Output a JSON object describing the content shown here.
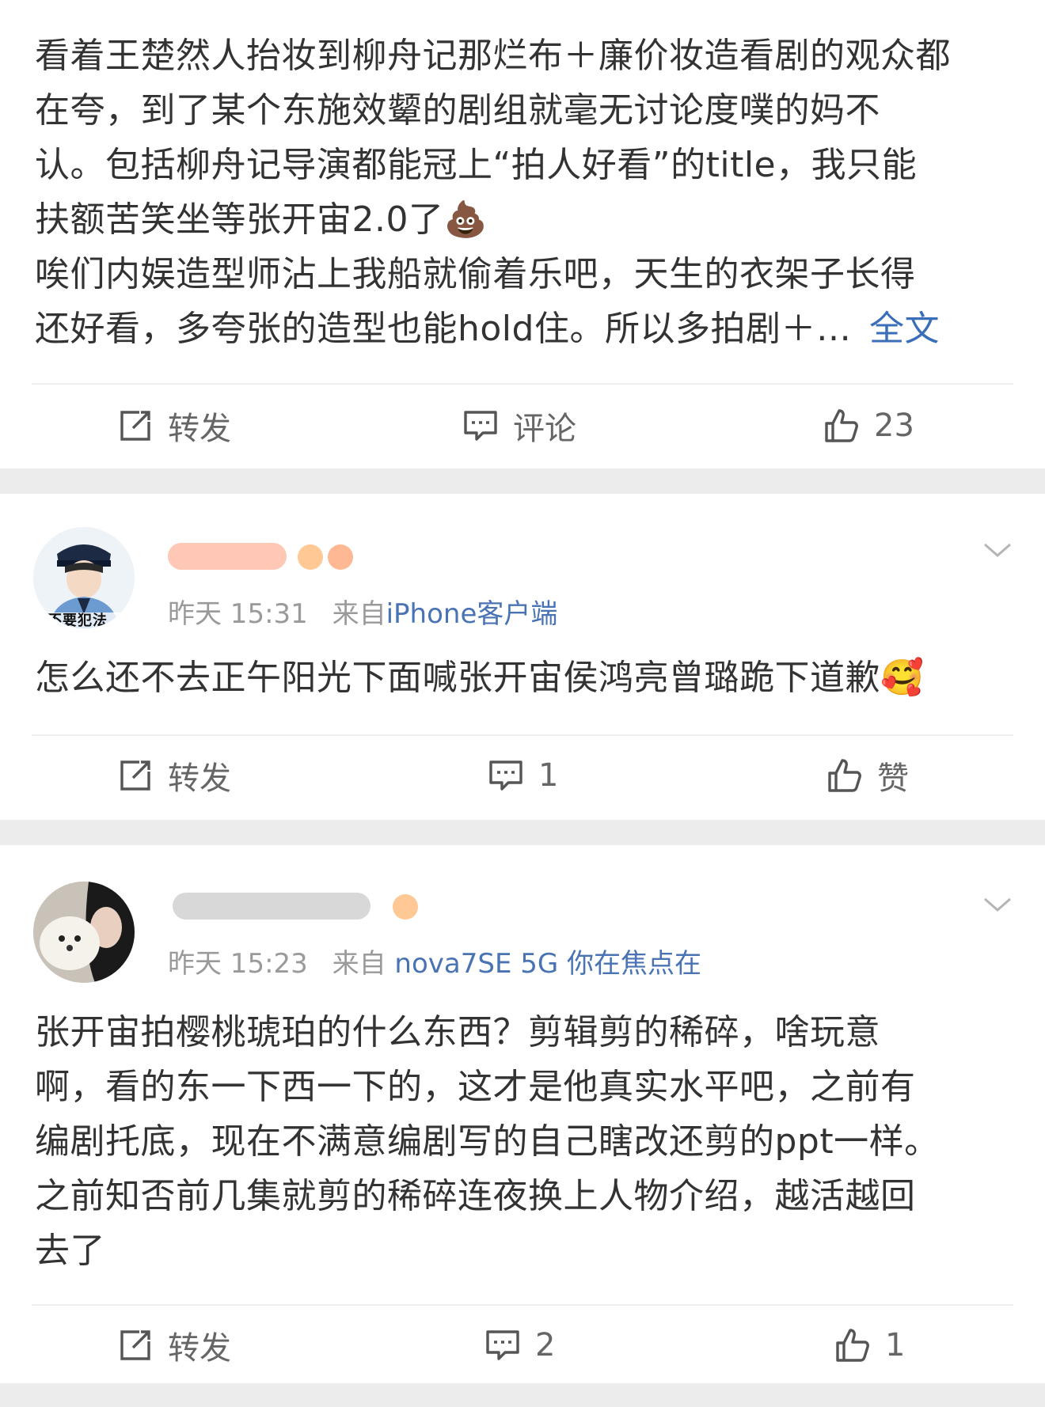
{
  "posts": [
    {
      "content_lines": [
        "看着王楚然人抬妆到柳舟记那烂布＋廉价妆造看剧的观众都",
        "在夸，到了某个东施效颦的剧组就毫无讨论度噗的妈不",
        "认。包括柳舟记导演都能冠上“拍人好看”的title，我只能",
        "扶额苦笑坐等张开宙2.0了💩",
        "唉们内娱造型师沾上我船就偷着乐吧，天生的衣架子长得",
        "还好看，多夸张的造型也能hold住。所以多拍剧＋…"
      ],
      "more_label": "全文",
      "repost_label": "转发",
      "comment_label": "评论",
      "like_label": "23"
    },
    {
      "time": "昨天 15:31",
      "from_prefix": "来自",
      "source": "iPhone客户端",
      "content_lines": [
        "怎么还不去正午阳光下面喊张开宙侯鸿亮曾璐跪下道歉🥰"
      ],
      "repost_label": "转发",
      "comment_label": "1",
      "like_label": "赞",
      "avatar_caption": "不要犯法"
    },
    {
      "time": "昨天 15:23",
      "from_prefix": "来自",
      "source": "nova7SE 5G 你在焦点在",
      "content_lines": [
        "张开宙拍樱桃琥珀的什么东西？剪辑剪的稀碎，啥玩意",
        "啊，看的东一下西一下的，这才是他真实水平吧，之前有",
        "编剧托底，现在不满意编剧写的自己瞎改还剪的ppt一样。",
        "之前知否前几集就剪的稀碎连夜换上人物介绍，越活越回",
        "去了"
      ],
      "repost_label": "转发",
      "comment_label": "2",
      "like_label": "1"
    }
  ],
  "colors": {
    "link": "#3a6fb7",
    "meta": "#9a9a9a",
    "text": "#333333",
    "separator": "#ececec"
  }
}
